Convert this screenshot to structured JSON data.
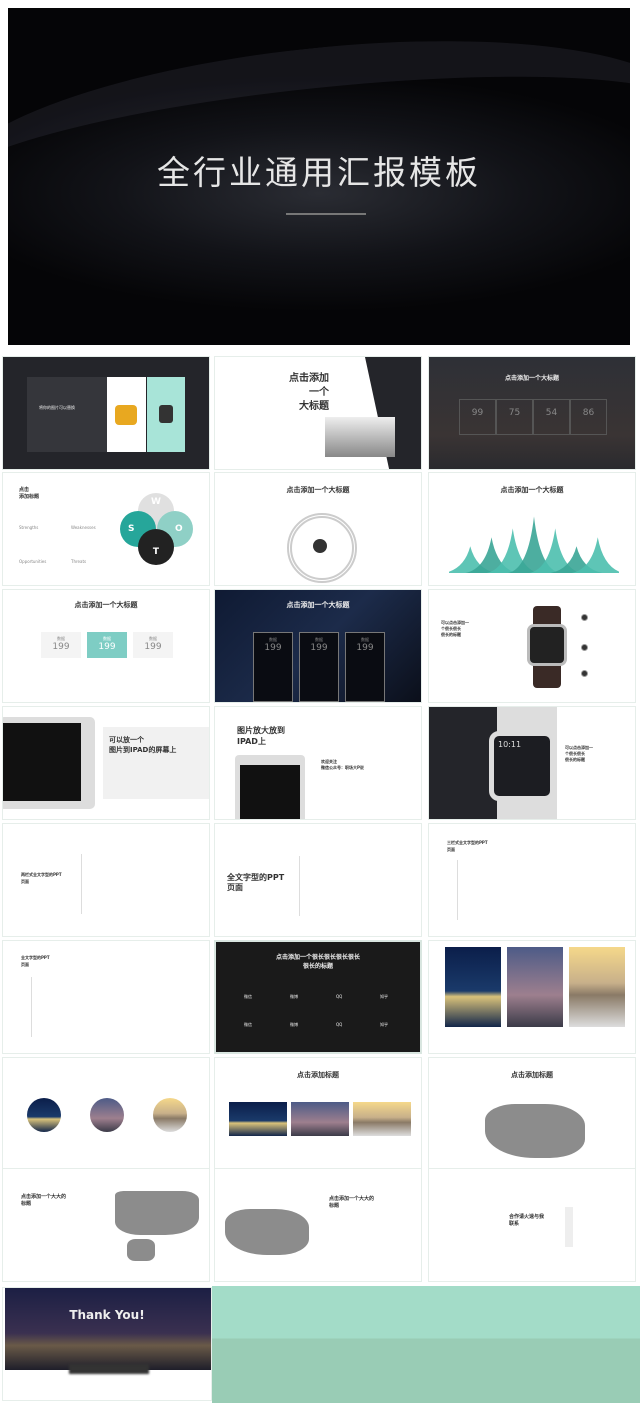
{
  "cover": {
    "title": "全行业通用汇报模板"
  },
  "slides": {
    "s1": {
      "caption": "将你的图片可以替换"
    },
    "s2": {
      "line1": "点击添加",
      "line2": "一个",
      "line3": "大标题"
    },
    "s3": {
      "title": "点击添加一个大标题",
      "values": [
        "99",
        "75",
        "54",
        "86"
      ]
    },
    "s4": {
      "title_line1": "点击",
      "title_line2": "添加标题",
      "labels": [
        "Strengths",
        "Weaknesses",
        "Opportunities",
        "Threats"
      ],
      "letters": [
        "W",
        "S",
        "O",
        "T"
      ],
      "colors": {
        "teal": "#26a69a",
        "light_teal": "#8fd0c6",
        "gray": "#e0e0e0",
        "dark": "#222222"
      }
    },
    "s5": {
      "title": "点击添加一个大标题"
    },
    "s6": {
      "title": "点击添加一个大标题",
      "peaks": [
        0.45,
        0.6,
        0.75,
        0.95,
        0.75,
        0.45,
        0.6
      ],
      "color": "#4dbfae"
    },
    "s7": {
      "title": "点击添加一个大标题",
      "cards": [
        {
          "label": "数据",
          "value": "199"
        },
        {
          "label": "数据",
          "value": "199"
        },
        {
          "label": "数据",
          "value": "199"
        }
      ],
      "accent": "#7ecdc4"
    },
    "s8": {
      "title": "点击添加一个大标题",
      "cards": [
        {
          "label": "数据",
          "value": "199"
        },
        {
          "label": "数据",
          "value": "199"
        },
        {
          "label": "数据",
          "value": "199"
        }
      ]
    },
    "s9": {
      "text_line1": "可以点击添加一",
      "text_line2": "个很长很长",
      "text_line3": "很长的标题"
    },
    "s10": {
      "line1": "可以放一个",
      "line2": "图片到IPAD的屏幕上"
    },
    "s11": {
      "line1": "图片放大放到",
      "line2": "IPAD上",
      "sub1": "欢迎关注",
      "sub2": "微信公众号：职场大P说"
    },
    "s12": {
      "time": "10:11",
      "text_line1": "可以点击添加一",
      "text_line2": "个很长很长",
      "text_line3": "很长的标题"
    },
    "s13": {
      "line1": "两栏式全文字型的PPT",
      "line2": "页面"
    },
    "s14": {
      "line1": "全文字型的PPT",
      "line2": "页面"
    },
    "s15": {
      "line1": "三栏式全文字型的PPT",
      "line2": "页面"
    },
    "s16": {
      "line1": "全文字型的PPT",
      "line2": "页面"
    },
    "s17": {
      "line1": "点击添加一个很长很长很长很长",
      "line2": "很长的标题",
      "items": [
        "微信",
        "微博",
        "QQ",
        "知乎",
        "微信",
        "微博",
        "QQ",
        "知乎"
      ]
    },
    "s20": {
      "title": "点击添加标题"
    },
    "s21": {
      "title": "点击添加标题"
    },
    "s22": {
      "line1": "点击添加一个大大的",
      "line2": "标题"
    },
    "s23": {
      "line1": "点击添加一个大大的",
      "line2": "标题"
    },
    "s24": {
      "line1": "合作请火速与我",
      "line2": "联系"
    },
    "s25": {
      "title": "Thank You!"
    }
  },
  "background_color": "#9fd6c2"
}
